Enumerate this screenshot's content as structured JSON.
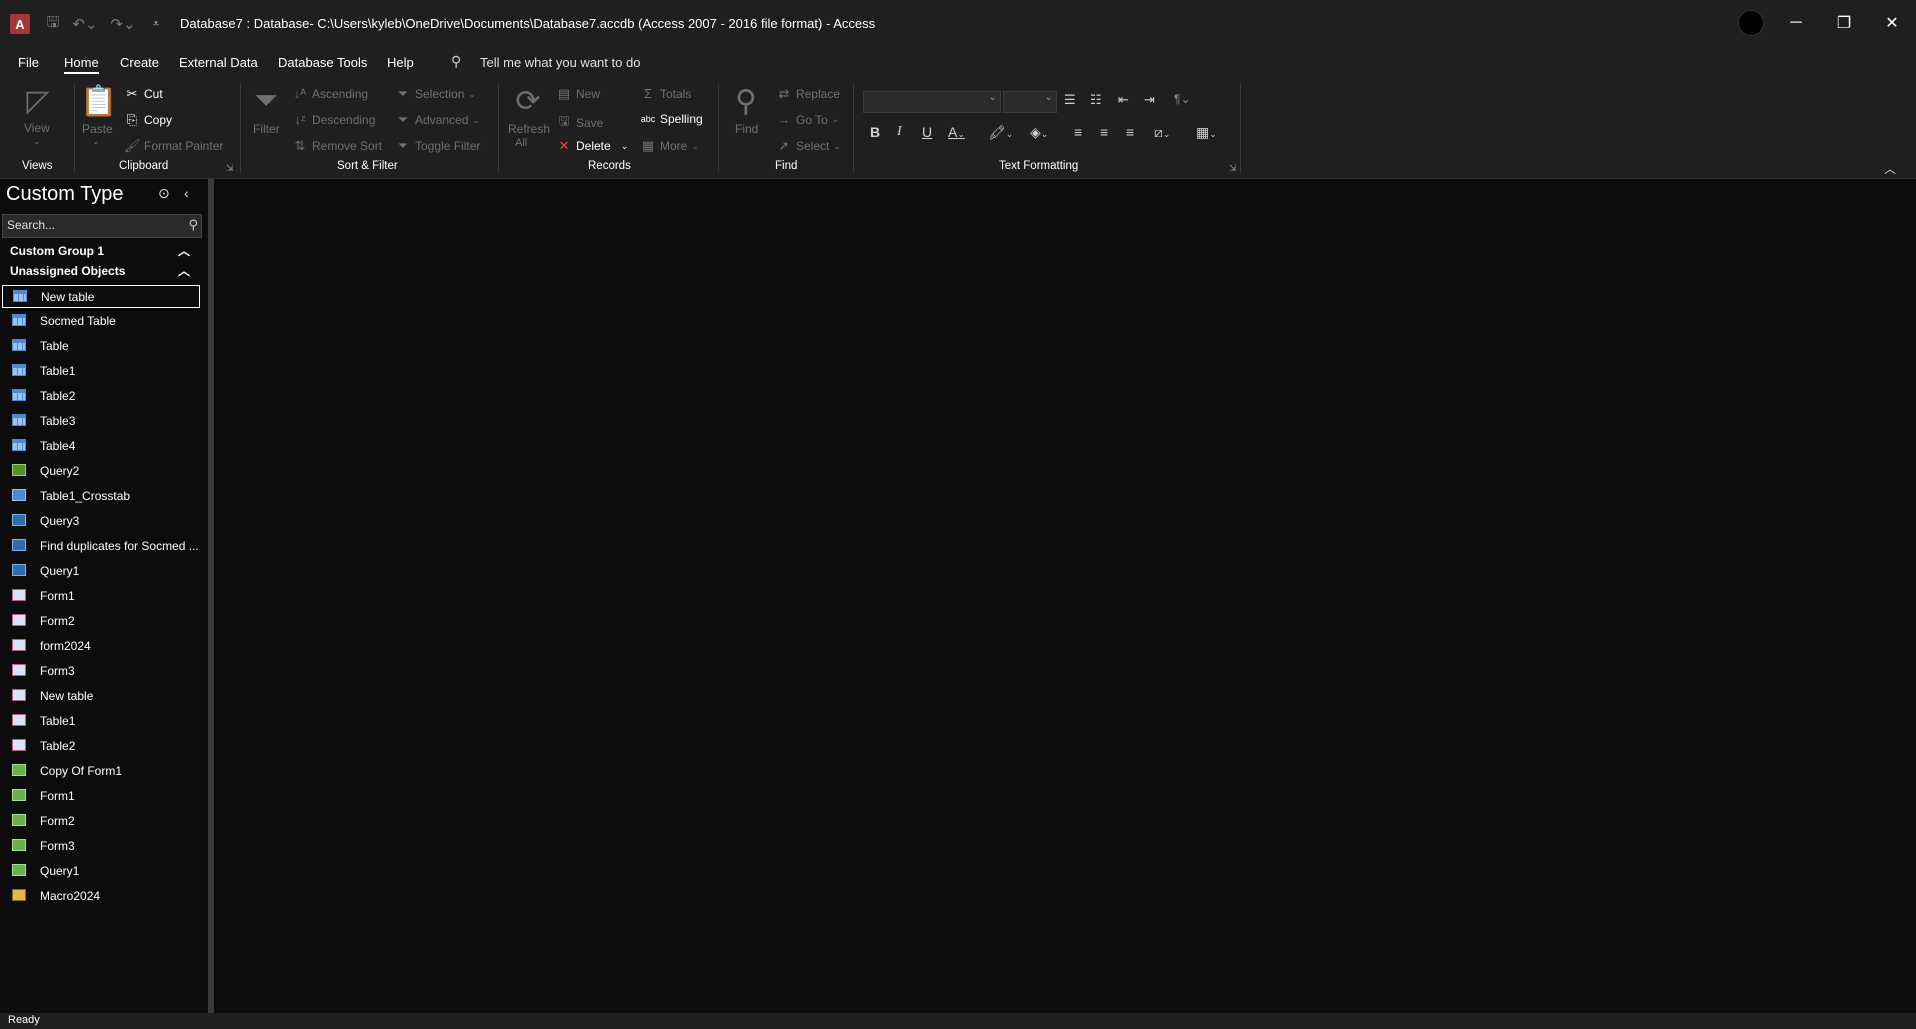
{
  "title_bar": {
    "app_icon_letter": "A",
    "window_title": "Database7 : Database- C:\\Users\\kyleb\\OneDrive\\Documents\\Database7.accdb (Access 2007 - 2016 file format)  -  Access"
  },
  "menu_tabs": [
    "File",
    "Home",
    "Create",
    "External Data",
    "Database Tools",
    "Help"
  ],
  "active_tab": "Home",
  "tell_me_placeholder": "Tell me what you want to do",
  "ribbon": {
    "views": {
      "view_label": "View",
      "group_label": "Views"
    },
    "clipboard": {
      "paste_label": "Paste",
      "cut_label": "Cut",
      "copy_label": "Copy",
      "format_painter_label": "Format Painter",
      "group_label": "Clipboard"
    },
    "sort_filter": {
      "filter_label": "Filter",
      "ascending_label": "Ascending",
      "descending_label": "Descending",
      "remove_sort_label": "Remove Sort",
      "selection_label": "Selection",
      "advanced_label": "Advanced",
      "toggle_filter_label": "Toggle Filter",
      "group_label": "Sort & Filter"
    },
    "records": {
      "refresh_label": "Refresh",
      "refresh_sub_label": "All",
      "new_label": "New",
      "save_label": "Save",
      "delete_label": "Delete",
      "totals_label": "Totals",
      "spelling_label": "Spelling",
      "more_label": "More",
      "group_label": "Records"
    },
    "find": {
      "find_label": "Find",
      "replace_label": "Replace",
      "goto_label": "Go To",
      "select_label": "Select",
      "group_label": "Find"
    },
    "text_formatting": {
      "bold": "B",
      "italic": "I",
      "underline": "U",
      "group_label": "Text Formatting"
    }
  },
  "nav_pane": {
    "title": "Custom Type",
    "search_placeholder": "Search...",
    "groups": [
      {
        "label": "Custom Group 1"
      },
      {
        "label": "Unassigned Objects"
      }
    ],
    "items": [
      {
        "label": "New table",
        "type": "table",
        "selected": true
      },
      {
        "label": "Socmed Table",
        "type": "table"
      },
      {
        "label": "Table",
        "type": "table"
      },
      {
        "label": "Table1",
        "type": "table"
      },
      {
        "label": "Table2",
        "type": "table"
      },
      {
        "label": "Table3",
        "type": "table"
      },
      {
        "label": "Table4",
        "type": "table"
      },
      {
        "label": "Query2",
        "type": "append"
      },
      {
        "label": "Table1_Crosstab",
        "type": "crosstab"
      },
      {
        "label": "Query3",
        "type": "query"
      },
      {
        "label": "Find duplicates for Socmed ...",
        "type": "query"
      },
      {
        "label": "Query1",
        "type": "query"
      },
      {
        "label": "Form1",
        "type": "form"
      },
      {
        "label": "Form2",
        "type": "form"
      },
      {
        "label": "form2024",
        "type": "form"
      },
      {
        "label": "Form3",
        "type": "form"
      },
      {
        "label": "New table",
        "type": "form"
      },
      {
        "label": "Table1",
        "type": "form"
      },
      {
        "label": "Table2",
        "type": "form"
      },
      {
        "label": "Copy Of Form1",
        "type": "report"
      },
      {
        "label": "Form1",
        "type": "report"
      },
      {
        "label": "Form2",
        "type": "report"
      },
      {
        "label": "Form3",
        "type": "report"
      },
      {
        "label": "Query1",
        "type": "report"
      },
      {
        "label": "Macro2024",
        "type": "macro"
      }
    ]
  },
  "status_bar": {
    "text": "Ready"
  }
}
